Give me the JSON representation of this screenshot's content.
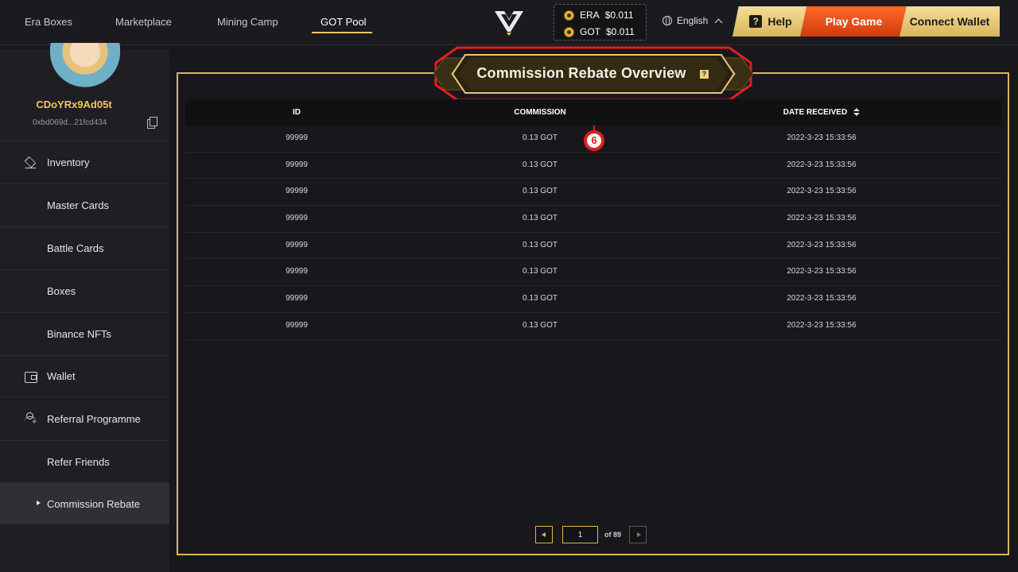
{
  "nav": {
    "items": [
      {
        "label": "Era Boxes"
      },
      {
        "label": "Marketplace"
      },
      {
        "label": "Mining Camp"
      },
      {
        "label": "GOT Pool"
      }
    ],
    "active": "GOT Pool"
  },
  "prices": {
    "era": {
      "symbol": "ERA",
      "price": "$0.011"
    },
    "got": {
      "symbol": "GOT",
      "price": "$0.011"
    }
  },
  "language": "English",
  "buttons": {
    "help": "Help",
    "play": "Play Game",
    "connect": "Connect Wallet"
  },
  "user": {
    "name": "CDoYRx9Ad05t",
    "address": "0xbd069d...21fcd434"
  },
  "sidebar": {
    "items": [
      {
        "label": "Inventory",
        "icon": "layers-icon"
      },
      {
        "label": "Master Cards"
      },
      {
        "label": "Battle Cards"
      },
      {
        "label": "Boxes"
      },
      {
        "label": "Binance NFTs"
      },
      {
        "label": "Wallet",
        "icon": "wallet-icon"
      },
      {
        "label": "Referral Programme",
        "icon": "user-add-icon"
      },
      {
        "label": "Refer Friends"
      },
      {
        "label": "Commission Rebate"
      }
    ],
    "active": "Commission Rebate"
  },
  "page": {
    "title": "Commission Rebate Overview",
    "help_glyph": "?",
    "annotation": "6"
  },
  "table": {
    "headers": {
      "id": "ID",
      "commission": "COMMISSION",
      "date": "DATE RECEIVED"
    },
    "rows": [
      {
        "id": "99999",
        "commission": "0.13 GOT",
        "date": "2022-3-23 15:33:56"
      },
      {
        "id": "99999",
        "commission": "0.13 GOT",
        "date": "2022-3-23 15:33:56"
      },
      {
        "id": "99999",
        "commission": "0.13 GOT",
        "date": "2022-3-23 15:33:56"
      },
      {
        "id": "99999",
        "commission": "0.13 GOT",
        "date": "2022-3-23 15:33:56"
      },
      {
        "id": "99999",
        "commission": "0.13 GOT",
        "date": "2022-3-23 15:33:56"
      },
      {
        "id": "99999",
        "commission": "0.13 GOT",
        "date": "2022-3-23 15:33:56"
      },
      {
        "id": "99999",
        "commission": "0.13 GOT",
        "date": "2022-3-23 15:33:56"
      },
      {
        "id": "99999",
        "commission": "0.13 GOT",
        "date": "2022-3-23 15:33:56"
      }
    ]
  },
  "pagination": {
    "current": "1",
    "total_label": "of 89"
  },
  "colors": {
    "accent": "#d9b75a",
    "play": "#e5541a",
    "annotation": "#e51c1c"
  }
}
